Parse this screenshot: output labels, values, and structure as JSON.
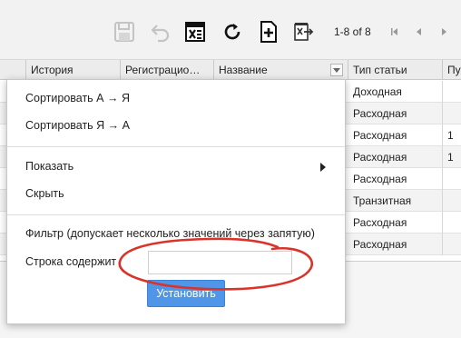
{
  "toolbar": {
    "icons": [
      "save-icon",
      "undo-icon",
      "excel-export-icon",
      "refresh-icon",
      "add-icon",
      "export-icon"
    ],
    "pager_text": "1-8 of 8"
  },
  "grid": {
    "columns": [
      "",
      "История",
      "Регистрацио…",
      "Название",
      "Тип статьи",
      "Пу"
    ],
    "rows": [
      {
        "type": "Доходная",
        "extra": ""
      },
      {
        "type": "Расходная",
        "extra": ""
      },
      {
        "type": "Расходная",
        "extra": "1"
      },
      {
        "type": "Расходная",
        "extra": "1"
      },
      {
        "type": "Расходная",
        "extra": ""
      },
      {
        "type": "Транзитная",
        "extra": ""
      },
      {
        "type": "Расходная",
        "extra": ""
      },
      {
        "type": "Расходная",
        "extra": ""
      }
    ]
  },
  "menu": {
    "sort_asc": "Сортировать А → Я",
    "sort_desc": "Сортировать Я → А",
    "show": "Показать",
    "hide": "Скрыть",
    "filter_label": "Фильтр (допускает несколько значений через запятую)",
    "contains_label": "Строка содержит",
    "contains_value": "",
    "apply_label": "Установить"
  },
  "colors": {
    "accent": "#4f95e8",
    "annotation": "#d9342b"
  }
}
